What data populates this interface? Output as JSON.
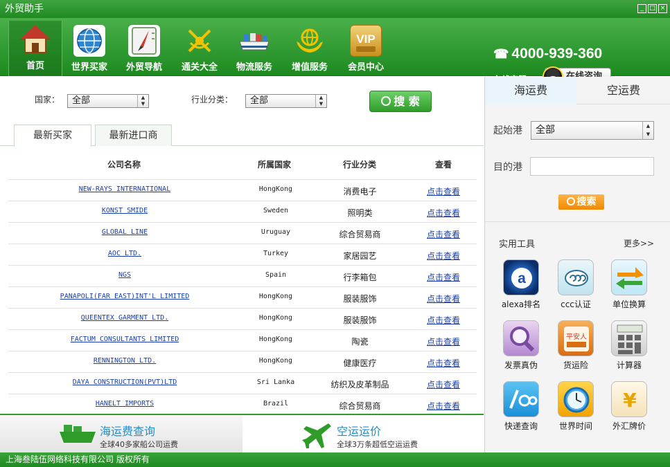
{
  "window": {
    "title": "外贸助手",
    "btn_min": "_",
    "btn_max": "□",
    "btn_close": "×"
  },
  "nav": {
    "items": [
      {
        "label": "首页",
        "icon": "home-icon"
      },
      {
        "label": "世界买家",
        "icon": "globe-icon"
      },
      {
        "label": "外贸导航",
        "icon": "compass-icon"
      },
      {
        "label": "通关大全",
        "icon": "customs-icon"
      },
      {
        "label": "物流服务",
        "icon": "ship-icon"
      },
      {
        "label": "增值服务",
        "icon": "hands-globe-icon"
      },
      {
        "label": "会员中心",
        "icon": "vip-icon"
      }
    ],
    "phone_icon": "☎",
    "phone": "4000-939-360",
    "online_label": "在线客服:",
    "online_button": "在线咨询"
  },
  "filters": {
    "country_label": "国家：",
    "country_value": "全部",
    "industry_label": "行业分类：",
    "industry_value": "全部",
    "search_label": "搜 索"
  },
  "tabs": [
    {
      "label": "最新买家"
    },
    {
      "label": "最新进口商"
    }
  ],
  "table": {
    "headers": [
      "公司名称",
      "所属国家",
      "行业分类",
      "查看"
    ],
    "rows": [
      {
        "company": "NEW-RAYS INTERNATIONAL",
        "country": "HongKong",
        "industry": "消费电子",
        "link": "点击查看"
      },
      {
        "company": "KONST SMIDE",
        "country": "Sweden",
        "industry": "照明类",
        "link": "点击查看"
      },
      {
        "company": "GLOBAL LINE",
        "country": "Uruguay",
        "industry": "综合贸易商",
        "link": "点击查看"
      },
      {
        "company": "AOC LTD.",
        "country": "Turkey",
        "industry": "家居园艺",
        "link": "点击查看"
      },
      {
        "company": "NGS",
        "country": "Spain",
        "industry": "行李箱包",
        "link": "点击查看"
      },
      {
        "company": "PANAPOLI(FAR EAST)INT'L LIMITED",
        "country": "HongKong",
        "industry": "服装服饰",
        "link": "点击查看"
      },
      {
        "company": "QUEENTEX GARMENT LTD.",
        "country": "HongKong",
        "industry": "服装服饰",
        "link": "点击查看"
      },
      {
        "company": "FACTUM CONSULTANTS LIMITED",
        "country": "HongKong",
        "industry": "陶瓷",
        "link": "点击查看"
      },
      {
        "company": "RENNINGTON LTD.",
        "country": "HongKong",
        "industry": "健康医疗",
        "link": "点击查看"
      },
      {
        "company": "DAYA CONSTRUCTION(PVT)LTD",
        "country": "Sri Lanka",
        "industry": "纺织及皮革制品",
        "link": "点击查看"
      },
      {
        "company": "HANELT IMPORTS",
        "country": "Brazil",
        "industry": "综合贸易商",
        "link": "点击查看"
      }
    ]
  },
  "bottom": {
    "sea_title": "海运费查询",
    "sea_sub": "全球40多家船公司运费",
    "air_title": "空运运价",
    "air_sub": "全球3万条超低空运运费"
  },
  "freight": {
    "tab_sea": "海运费",
    "tab_air": "空运费",
    "origin_label": "起始港",
    "origin_value": "全部",
    "dest_label": "目的港",
    "dest_value": "",
    "search_label": "搜索"
  },
  "tools": {
    "title": "实用工具",
    "more": "更多>>",
    "items": [
      {
        "label": "alexa排名",
        "icon": "alexa-icon"
      },
      {
        "label": "ccc认证",
        "icon": "ccc-icon"
      },
      {
        "label": "单位换算",
        "icon": "convert-arrows-icon"
      },
      {
        "label": "发票真伪",
        "icon": "magnifier-icon"
      },
      {
        "label": "货运险",
        "icon": "insurance-icon"
      },
      {
        "label": "计算器",
        "icon": "calculator-icon"
      },
      {
        "label": "快递查询",
        "icon": "express-icon"
      },
      {
        "label": "世界时间",
        "icon": "clock-icon"
      },
      {
        "label": "外汇牌价",
        "icon": "currency-icon"
      }
    ],
    "insurance_badge": "平安人",
    "currency_symbol": "¥"
  },
  "footer": {
    "text": "上海叁陆伍网络科技有限公司 版权所有"
  },
  "colors": {
    "brand_green": "#2f9c2a",
    "link_blue": "#1a3fa8",
    "accent_orange": "#f08a00"
  }
}
